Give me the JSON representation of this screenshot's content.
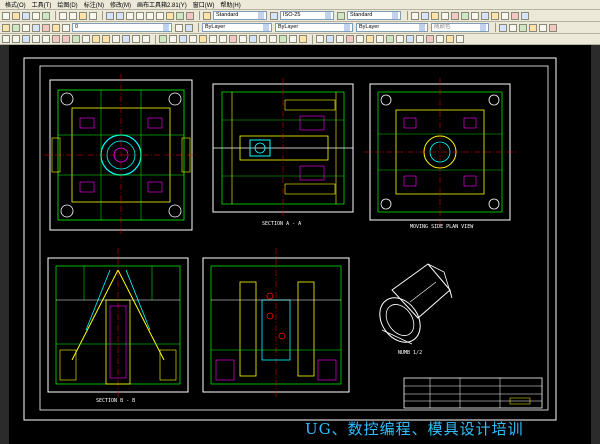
{
  "menu": {
    "items": [
      "格式(O)",
      "工具(T)",
      "绘图(D)",
      "标注(N)",
      "修改(M)",
      "画布工具箱2.81(Y)",
      "窗口(W)",
      "帮助(H)"
    ]
  },
  "toolbar1": {
    "text_style": "Standard",
    "dim_style": "ISO-25",
    "table_style": "Standard"
  },
  "toolbar2": {
    "layer": "0",
    "color": "ByLayer",
    "linetype": "ByLayer",
    "lineweight": "ByLayer",
    "plotstyle": "随颜色"
  },
  "drawing": {
    "labels": {
      "section_aa": "SECTION A - A",
      "moving_half": "MOVING SIDE PLAN VIEW",
      "section_bb": "SECTION B - B",
      "part": "NUMB 1/2"
    }
  },
  "colors": {
    "background": "#000000",
    "frame": "#ffffff",
    "watermark": "#2fbfff"
  },
  "watermark": {
    "text": "UG、数控编程、模具设计培训"
  }
}
